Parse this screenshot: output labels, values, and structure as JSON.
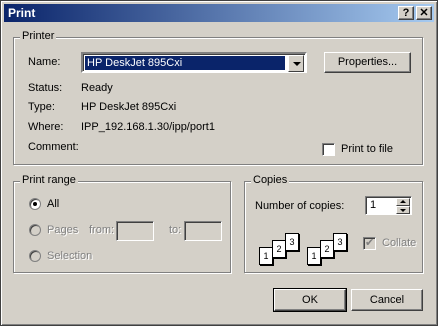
{
  "window": {
    "title": "Print",
    "help_label": "?",
    "close_label": "✕"
  },
  "printer": {
    "group_label": "Printer",
    "name_label": "Name:",
    "name_value": "HP DeskJet 895Cxi",
    "properties_label": "Properties...",
    "status_label": "Status:",
    "status_value": "Ready",
    "type_label": "Type:",
    "type_value": "HP DeskJet 895Cxi",
    "where_label": "Where:",
    "where_value": "IPP_192.168.1.30/ipp/port1",
    "comment_label": "Comment:",
    "print_to_file_label": "Print to file"
  },
  "print_range": {
    "group_label": "Print range",
    "all_label": "All",
    "pages_label": "Pages",
    "from_label": "from:",
    "to_label": "to:",
    "selection_label": "Selection"
  },
  "copies": {
    "group_label": "Copies",
    "number_label": "Number of copies:",
    "number_value": "1",
    "collate_label": "Collate",
    "collate_pages": [
      "1",
      "2",
      "3"
    ]
  },
  "actions": {
    "ok_label": "OK",
    "cancel_label": "Cancel"
  }
}
